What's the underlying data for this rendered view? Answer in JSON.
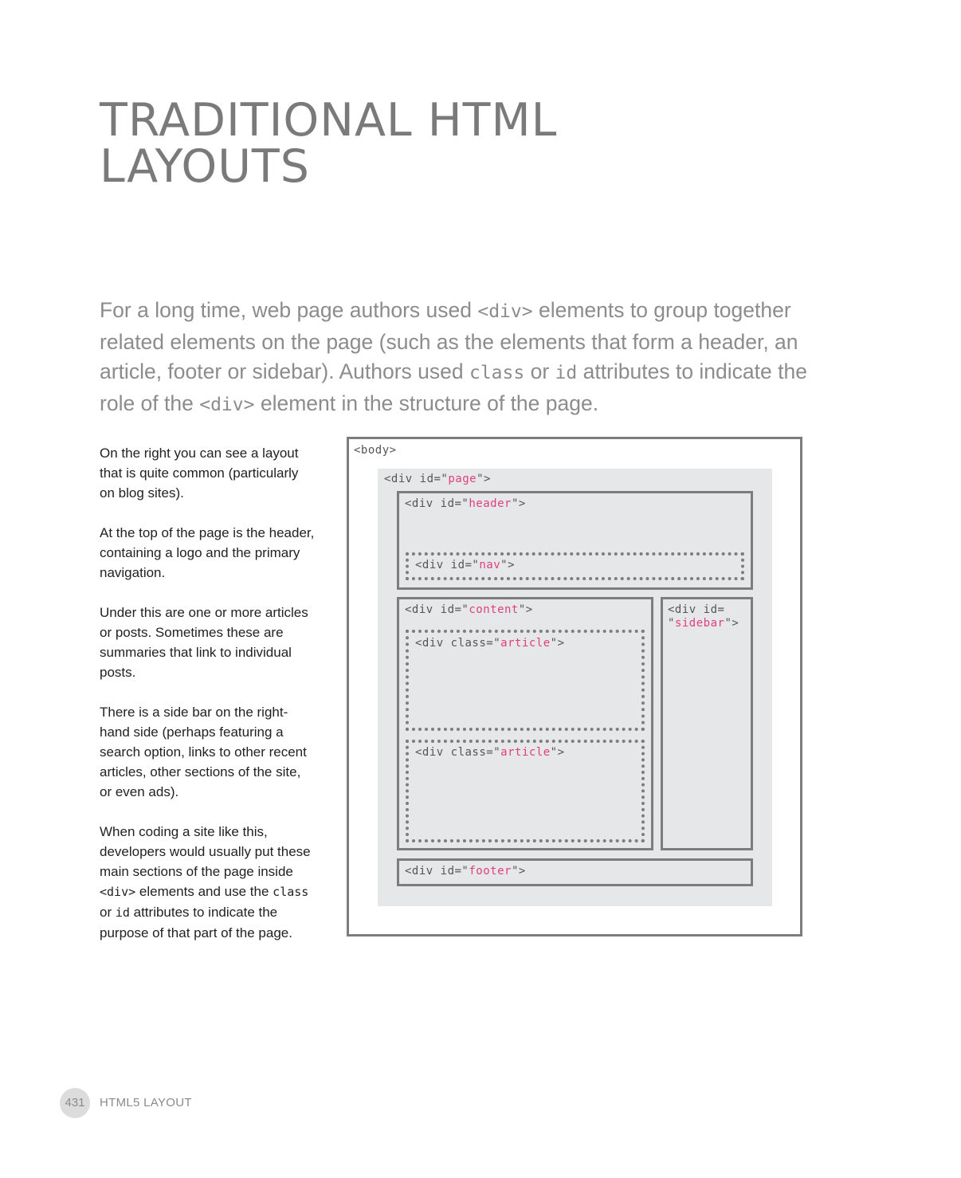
{
  "title": {
    "line1": "TRADITIONAL HTML",
    "line2": "LAYOUTS"
  },
  "intro": {
    "part1": "For a long time, web page authors used ",
    "code_div": "<div>",
    "part2": " elements to group together related elements on the page (such as the elements that form a header, an article, footer or sidebar). Authors used ",
    "code_class": "class",
    "part3": " or ",
    "code_id": "id",
    "part4": " attributes to indicate the role of the ",
    "code_div2": "<div>",
    "part5": " element in the structure of the page."
  },
  "side": {
    "p1": "On the right you can see a layout that is quite common (particularly on blog sites).",
    "p2": "At the top of the page is the header, containing a logo and the primary navigation.",
    "p3": "Under this are one or more articles or posts. Sometimes these are summaries that link to individual posts.",
    "p4": "There is a side bar on the right-hand side (perhaps featuring a search option, links to other recent articles, other sections of the site, or even ads).",
    "p5": {
      "a": "When coding a site like this, developers would usually put these main sections of the page inside ",
      "code_div": "<div>",
      "b": " elements and use the ",
      "code_class": "class",
      "c": " or ",
      "code_id": "id",
      "d": " attributes to indicate the purpose of that part of the page."
    }
  },
  "diagram": {
    "body": "<body>",
    "page": {
      "pre": "<div id=\"",
      "val": "page",
      "post": "\">"
    },
    "header": {
      "pre": "<div id=\"",
      "val": "header",
      "post": "\">"
    },
    "nav": {
      "pre": "<div id=\"",
      "val": "nav",
      "post": "\">"
    },
    "content": {
      "pre": "<div id=\"",
      "val": "content",
      "post": "\">"
    },
    "article1": {
      "pre": "<div class=\"",
      "val": "article",
      "post": "\">"
    },
    "article2": {
      "pre": "<div class=\"",
      "val": "article",
      "post": "\">"
    },
    "sidebar": {
      "pre": "<div id=",
      "pre2": "\"",
      "val": "sidebar",
      "post": "\">"
    },
    "footer": {
      "pre": "<div id=\"",
      "val": "footer",
      "post": "\">"
    }
  },
  "colors": {
    "highlight": "#e0407a",
    "heading": "#7a7a7a",
    "box_border": "#7d7d7d",
    "page_bg": "#e6e7e8"
  },
  "footer": {
    "page_number": "431",
    "section": "HTML5 LAYOUT"
  }
}
